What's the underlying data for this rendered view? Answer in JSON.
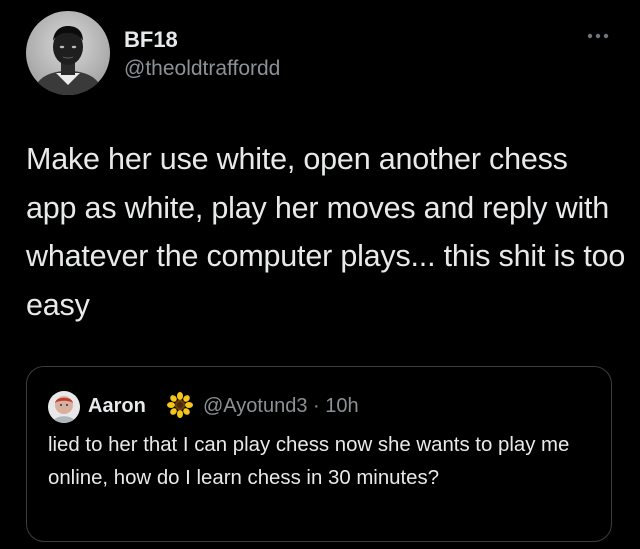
{
  "tweet": {
    "author": {
      "display_name": "BF18",
      "handle": "@theoldtraffordd"
    },
    "text": "Make her use white, open another chess app as white, play her moves and reply with whatever the computer plays... this shit is too easy",
    "more_icon": "more-horizontal-icon"
  },
  "quoted_tweet": {
    "author": {
      "display_name": "Aaron",
      "emoji": "sunflower-icon",
      "handle": "@Ayotund3",
      "time": "10h",
      "separator": "·"
    },
    "meta_line": "@Ayotund3 · 10h",
    "text": "lied to her that I can play chess now she wants to play me online, how do I learn chess in 30 minutes?"
  },
  "colors": {
    "background": "#000000",
    "primary_text": "#e7e9ea",
    "secondary_text": "#8b9196",
    "card_border": "#3a3d41"
  }
}
